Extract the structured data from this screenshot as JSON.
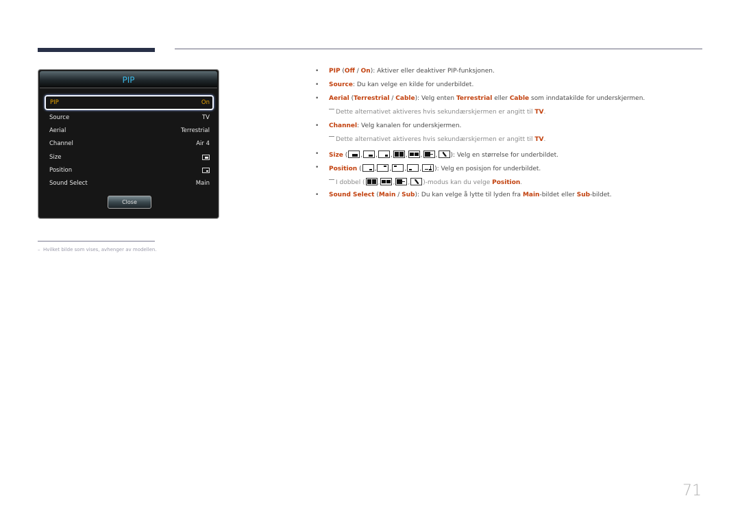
{
  "osd": {
    "title": "PIP",
    "rows": [
      {
        "label": "PIP",
        "value": "On",
        "selected": true
      },
      {
        "label": "Source",
        "value": "TV"
      },
      {
        "label": "Aerial",
        "value": "Terrestrial"
      },
      {
        "label": "Channel",
        "value": "Air 4"
      },
      {
        "label": "Size",
        "value_icon": "size-small-icon"
      },
      {
        "label": "Position",
        "value_icon": "position-bottom-right-icon"
      },
      {
        "label": "Sound Select",
        "value": "Main"
      }
    ],
    "close_label": "Close"
  },
  "desc": {
    "pip": {
      "term": "PIP",
      "open": " (",
      "off": "Off",
      "sep": " / ",
      "on": "On",
      "rest": "): Aktiver eller deaktiver PIP-funksjonen."
    },
    "source": {
      "term": "Source",
      "rest": ": Du kan velge en kilde for underbildet."
    },
    "aerial": {
      "term": "Aerial",
      "open": " (",
      "terrestrial": "Terrestrial",
      "sep": " / ",
      "cable": "Cable",
      "mid": "): Velg enten ",
      "terrestrial2": "Terrestrial",
      "or": " eller ",
      "cable2": "Cable",
      "rest": " som inndatakilde for underskjermen."
    },
    "note1": {
      "text": "Dette alternativet aktiveres hvis sekundærskjermen er angitt til ",
      "tv": "TV",
      "end": "."
    },
    "channel": {
      "term": "Channel",
      "rest": ": Velg kanalen for underskjermen."
    },
    "note2": {
      "text": "Dette alternativet aktiveres hvis sekundærskjermen er angitt til ",
      "tv": "TV",
      "end": "."
    },
    "size": {
      "term": "Size",
      "open": " (",
      "rest": "): Velg en størrelse for underbildet."
    },
    "position": {
      "term": "Position",
      "open": " (",
      "rest": "): Velg en posisjon for underbildet."
    },
    "note3": {
      "text": "I dobbel (",
      "rest": ")-modus kan du velge ",
      "term": "Position",
      "end": "."
    },
    "sound": {
      "term": "Sound Select",
      "open": " (",
      "main": "Main",
      "sep": " / ",
      "sub": "Sub",
      "mid": "): Du kan velge å lytte til lyden fra ",
      "main2": "Main",
      "mid2": "-bildet eller ",
      "sub2": "Sub",
      "end": "-bildet."
    }
  },
  "footnote": "Hvilket bilde som vises, avhenger av modellen.",
  "page_number": "71",
  "colors": {
    "accent": "#c2410e",
    "osd_title": "#3ab8e6",
    "osd_selected": "#e9a400",
    "header_bar": "#283047"
  }
}
